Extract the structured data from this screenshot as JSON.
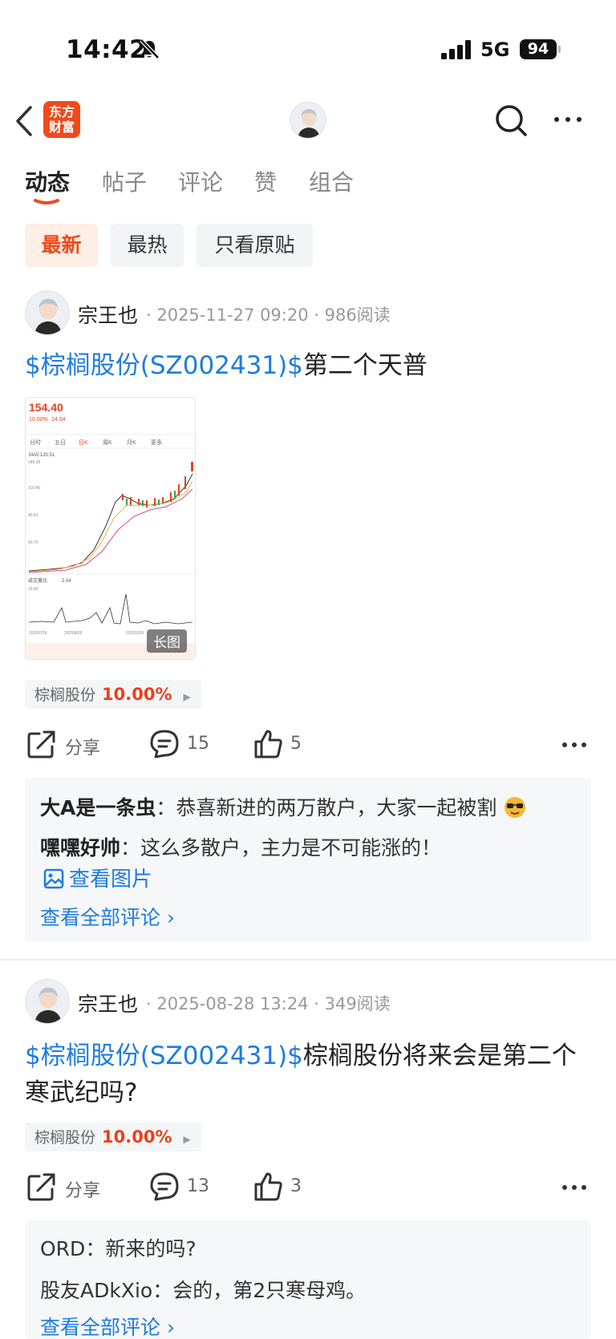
{
  "status_bar": {
    "time": "14:42",
    "network": "5G",
    "battery": "94"
  },
  "nav": {
    "logo_line1": "东方",
    "logo_line2": "财富"
  },
  "tabs": [
    {
      "label": "动态"
    },
    {
      "label": "帖子"
    },
    {
      "label": "评论"
    },
    {
      "label": "赞"
    },
    {
      "label": "组合"
    }
  ],
  "filters": [
    {
      "label": "最新"
    },
    {
      "label": "最热"
    },
    {
      "label": "只看原贴"
    }
  ],
  "posts": [
    {
      "author": "宗王也",
      "meta": "· 2025-11-27 09:20 · 986阅读",
      "stock_tag": "$棕榈股份(SZ002431)$",
      "title": "第二个天普",
      "image_label": "长图",
      "stock_chip": {
        "name": "棕榈股份",
        "pct": "10.00%"
      },
      "actions": {
        "share": "分享",
        "comments": "15",
        "likes": "5"
      },
      "comments": [
        {
          "user": "大A是一条虫",
          "text": "：恭喜新进的两万散户，大家一起被割"
        },
        {
          "user": "嘿嘿好帅",
          "text": "：这么多散户，主力是不可能涨的！"
        }
      ],
      "view_image": "查看图片",
      "view_all": "查看全部评论 ›",
      "chart_image": {
        "price": "154.40",
        "change": "10.00%",
        "change_abs": "14.04",
        "tabs": [
          "分时",
          "五日",
          "日K",
          "周K",
          "月K",
          "更多"
        ],
        "ma_label": "MA5:120.51",
        "y_ticks": [
          "140.36",
          "110.49",
          "80.63",
          "50.76"
        ],
        "vol_label": "成交量比",
        "vol_value": "2.04",
        "vol_max": "19.69",
        "dates": [
          "20250729",
          "20250828",
          "20251029"
        ],
        "colors": {
          "up": "#e8411c",
          "ma1": "#333333",
          "ma2": "#e8b53c",
          "ma3": "#d9478f"
        }
      }
    },
    {
      "author": "宗王也",
      "meta": "· 2025-08-28 13:24 · 349阅读",
      "stock_tag": "$棕榈股份(SZ002431)$",
      "title": "棕榈股份将来会是第二个寒武纪吗?",
      "stock_chip": {
        "name": "棕榈股份",
        "pct": "10.00%"
      },
      "actions": {
        "share": "分享",
        "comments": "13",
        "likes": "3"
      },
      "comments": [
        {
          "user": "ORD",
          "text": "：新来的吗?"
        },
        {
          "user": "股友ADkXio",
          "text": "：会的，第2只寒母鸡。"
        }
      ],
      "view_all": "查看全部评论 ›"
    }
  ],
  "colors": {
    "accent": "#f04a1c",
    "link": "#1e7ce0",
    "up": "#e8411c"
  }
}
